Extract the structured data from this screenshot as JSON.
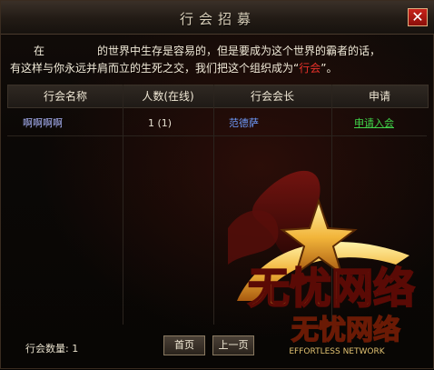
{
  "window": {
    "title": "行会招募",
    "close_label": "✕"
  },
  "intro": {
    "line1_a": "在",
    "line1_b": "的世界中生存是容易的，但是要成为这个世界的霸者的话，",
    "line2_a": "有这样与你永远并肩而立的生死之交，我们把这个组织成为“",
    "line2_highlight": "行会",
    "line2_b": "”。"
  },
  "table": {
    "headers": [
      "行会名称",
      "人数(在线)",
      "行会会长",
      "申请"
    ],
    "rows": [
      {
        "name": "啊啊啊啊",
        "members": "1 (1)",
        "leader": "范德萨",
        "action": "申请入会"
      }
    ]
  },
  "footer": {
    "count_label": "行会数量: 1",
    "first_page": "首页",
    "prev_page": "上一页"
  },
  "watermark": {
    "text": "无忧网络",
    "subtext": "EFFORTLESS NETWORK"
  },
  "colors": {
    "highlight": "#e8322a",
    "link": "#41d64a",
    "leader": "#6f9cff",
    "close": "#c8221a"
  }
}
